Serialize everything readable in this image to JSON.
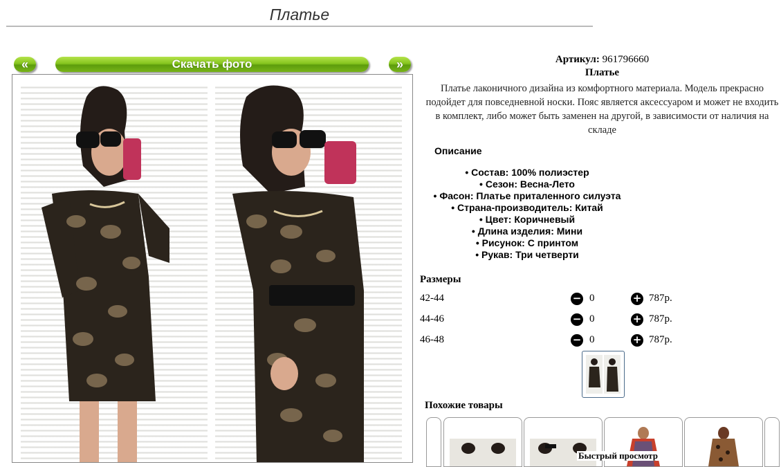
{
  "page": {
    "title": "Платье"
  },
  "gallery": {
    "prev_label": "«",
    "next_label": "»",
    "download_label": "Скачать фото"
  },
  "product": {
    "article_label": "Артикул:",
    "article_value": "961796660",
    "name": "Платье",
    "description": "Платье лаконичного дизайна из комфортного материала. Модель прекрасно подойдет для повседневной носки. Пояс является аксессуаром и может не входить в комплект, либо может быть заменен на другой, в зависимости от наличия на складе",
    "specs_heading": "Описание",
    "specs": [
      "Состав: 100% полиэстер",
      "Сезон: Весна-Лето",
      "Фасон: Платье приталенного силуэта",
      "Страна-производитель: Китай",
      "Цвет: Коричневый",
      "Длина изделия: Мини",
      "Рисунок: С принтом",
      "Рукав: Три четверти"
    ]
  },
  "sizes": {
    "heading": "Размеры",
    "rows": [
      {
        "size": "42-44",
        "qty": "0",
        "price": "787р."
      },
      {
        "size": "44-46",
        "qty": "0",
        "price": "787р."
      },
      {
        "size": "46-48",
        "qty": "0",
        "price": "787р."
      }
    ]
  },
  "similar": {
    "heading": "Похожие товары",
    "quick_view": "Быстрый просмотр"
  },
  "icons": {
    "minus": "minus-circle-icon",
    "plus": "plus-circle-icon"
  },
  "colors": {
    "accent_green": "#86c51e",
    "dress_brown": "#2b241c"
  }
}
